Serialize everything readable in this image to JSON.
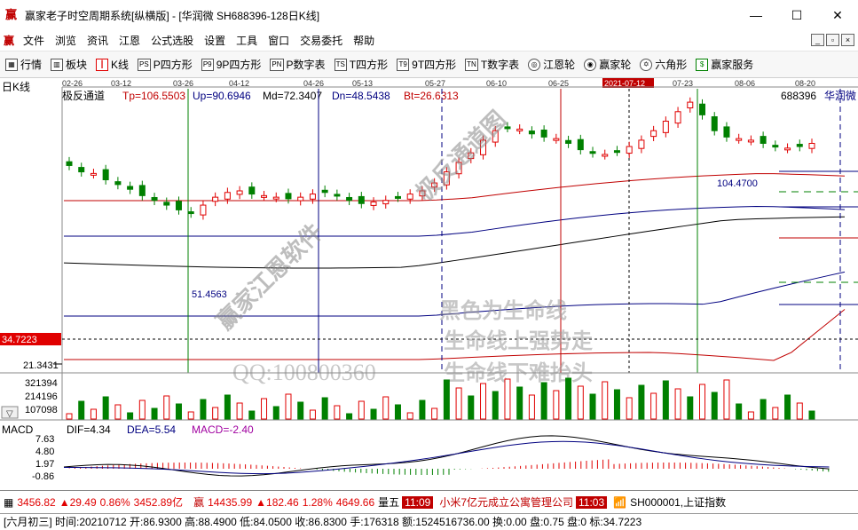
{
  "window": {
    "title": "赢家老子时空周期系统[纵横版] - [华润微  SH688396-128日K线]",
    "app_icon": "赢"
  },
  "window_buttons": {
    "minimize": "—",
    "maximize": "☐",
    "close": "✕"
  },
  "menu": {
    "logo": "赢",
    "items": [
      "文件",
      "浏览",
      "资讯",
      "江恩",
      "公式选股",
      "设置",
      "工具",
      "窗口",
      "交易委托",
      "帮助"
    ]
  },
  "mdi_buttons": [
    "_",
    "▫",
    "×"
  ],
  "toolbar": {
    "items": [
      {
        "icon": "grid-icon",
        "glyph": "▦",
        "label": "行情"
      },
      {
        "icon": "blocks-icon",
        "glyph": "▥",
        "label": "板块"
      },
      {
        "icon": "candle-icon",
        "glyph": "┃",
        "label": "K线"
      },
      {
        "icon": "ps-icon",
        "glyph": "PS",
        "label": "P四方形"
      },
      {
        "icon": "p9-icon",
        "glyph": "P9",
        "label": "9P四方形"
      },
      {
        "icon": "pn-icon",
        "glyph": "PN",
        "label": "P数字表"
      },
      {
        "icon": "ts-icon",
        "glyph": "TS",
        "label": "T四方形"
      },
      {
        "icon": "t9-icon",
        "glyph": "T9",
        "label": "9T四方形"
      },
      {
        "icon": "tn-icon",
        "glyph": "TN",
        "label": "T数字表"
      },
      {
        "icon": "gann-wheel-icon",
        "glyph": "◎",
        "label": "江恩轮"
      },
      {
        "icon": "winner-wheel-icon",
        "glyph": "◉",
        "label": "赢家轮"
      },
      {
        "icon": "hexagon-icon",
        "glyph": "✡",
        "label": "六角形"
      },
      {
        "icon": "dollar-icon",
        "glyph": "$",
        "label": "赢家服务"
      }
    ]
  },
  "chart": {
    "period_label": "日K线",
    "indicator_name": "极反通道",
    "params": {
      "tp": "Tp=106.5503",
      "up": "Up=90.6946",
      "md": "Md=72.3407",
      "dn": "Dn=48.5438",
      "bt": "Bt=26.6313"
    },
    "stock_code": "688396",
    "stock_name": "华润微",
    "date_ticks": [
      "02-26",
      "03-12",
      "03-26",
      "04-12",
      "04-26",
      "05-13",
      "05-27",
      "06-10",
      "06-25",
      "2021-07-12",
      "07-23",
      "08-06",
      "08-20"
    ],
    "price_labels": {
      "cursor": "34.7223",
      "low": "21.3431"
    },
    "annotations": {
      "high": "104.4700",
      "low": "51.4563"
    },
    "watermarks": [
      "极反通道图",
      "赢家江恩软件",
      "黑色为生命线",
      "生命线上强势走",
      "生命线下难抬头",
      "QQ:100800360"
    ],
    "volume_ticks": [
      "321394",
      "214196",
      "107098"
    ],
    "macd": {
      "label": "MACD",
      "dif": "DIF=4.34",
      "dea": "DEA=5.54",
      "macd": "MACD=-2.40",
      "ticks": [
        "7.63",
        "4.80",
        "1.97",
        "-0.86"
      ]
    },
    "colors": {
      "up": "#e00000",
      "down": "#008000",
      "channel": "#c00000",
      "mid": "#000080",
      "life_line": "#000000"
    }
  },
  "chart_data": {
    "type": "candlestick",
    "x_range": [
      "2021-02-22",
      "2021-08-31"
    ],
    "y_range": [
      21.3431,
      106.5503
    ],
    "values": [
      84.0,
      82.0,
      81.5,
      79.5,
      78.0,
      76.5,
      74.5,
      73.0,
      71.5,
      70.0,
      69.0,
      71.5,
      74.0,
      75.5,
      76.0,
      75.0,
      74.5,
      74.0,
      73.5,
      74.0,
      75.0,
      75.5,
      74.5,
      73.0,
      72.0,
      72.5,
      73.0,
      74.0,
      75.0,
      76.0,
      78.5,
      82.0,
      85.0,
      88.0,
      92.0,
      95.0,
      96.0,
      95.5,
      94.0,
      93.0,
      92.5,
      91.0,
      89.0,
      88.0,
      87.5,
      88.5,
      90.0,
      92.0,
      95.0,
      98.0,
      101.0,
      104.0,
      100.0,
      95.0,
      93.0,
      92.5,
      92.0,
      91.0,
      90.0,
      89.5,
      90.0,
      91.0
    ],
    "volume_ticks": [
      321394,
      214196,
      107098
    ],
    "macd": {
      "dif": 4.34,
      "dea": 5.54,
      "macd": -2.4,
      "y_range": [
        -0.86,
        7.63
      ]
    }
  },
  "status": {
    "index1": {
      "value": "3456.82",
      "change": "▲29.49",
      "pct": "0.86%",
      "amount": "3452.89亿"
    },
    "index2_icon": "赢",
    "index2": {
      "value": "14435.99",
      "change": "▲182.46",
      "pct": "1.28%",
      "amount": "4649.66"
    },
    "tag": "量五",
    "time1": "11:09",
    "news": "小米7亿元成立公寓管理公司",
    "time2": "11:03",
    "signal_icon": "📶",
    "market": "SH000001,上证指数"
  },
  "info": {
    "text": "[六月初三] 时间:20210712 开:86.9300 高:88.4900 低:84.0500 收:86.8300 手:176318 额:1524516736.00 换:0.00 盘:0.75 盘:0 标:34.7223"
  }
}
